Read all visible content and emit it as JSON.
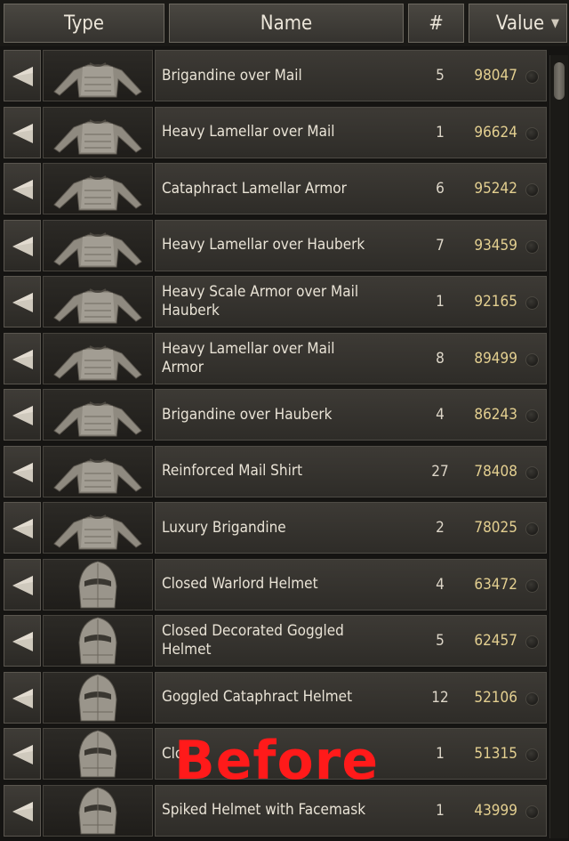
{
  "header": {
    "type_label": "Type",
    "name_label": "Name",
    "count_label": "#",
    "value_label": "Value",
    "sort_icon": "triangle-down-icon"
  },
  "items": [
    {
      "name": "Brigandine over Mail",
      "count": "5",
      "value": "98047",
      "icon": "body-armor-icon"
    },
    {
      "name": "Heavy Lamellar over Mail",
      "count": "1",
      "value": "96624",
      "icon": "body-armor-icon"
    },
    {
      "name": "Cataphract Lamellar Armor",
      "count": "6",
      "value": "95242",
      "icon": "body-armor-icon"
    },
    {
      "name": "Heavy Lamellar over Hauberk",
      "count": "7",
      "value": "93459",
      "icon": "body-armor-icon"
    },
    {
      "name": "Heavy Scale Armor over Mail Hauberk",
      "count": "1",
      "value": "92165",
      "icon": "body-armor-icon"
    },
    {
      "name": "Heavy Lamellar over Mail Armor",
      "count": "8",
      "value": "89499",
      "icon": "body-armor-icon"
    },
    {
      "name": "Brigandine over Hauberk",
      "count": "4",
      "value": "86243",
      "icon": "body-armor-icon"
    },
    {
      "name": "Reinforced Mail Shirt",
      "count": "27",
      "value": "78408",
      "icon": "body-armor-icon"
    },
    {
      "name": "Luxury Brigandine",
      "count": "2",
      "value": "78025",
      "icon": "body-armor-icon"
    },
    {
      "name": "Closed Warlord Helmet",
      "count": "4",
      "value": "63472",
      "icon": "helmet-icon"
    },
    {
      "name": "Closed Decorated Goggled Helmet",
      "count": "5",
      "value": "62457",
      "icon": "helmet-icon"
    },
    {
      "name": "Goggled Cataphract Helmet",
      "count": "12",
      "value": "52106",
      "icon": "helmet-icon"
    },
    {
      "name": "Clo",
      "count": "1",
      "value": "51315",
      "icon": "helmet-icon"
    },
    {
      "name": "Spiked Helmet with Facemask",
      "count": "1",
      "value": "43999",
      "icon": "helmet-icon"
    }
  ],
  "overlay": {
    "watermark_text": "Before",
    "watermark_color": "#ff1a1a"
  },
  "colors": {
    "value_text": "#e3cf90",
    "row_bg": "#3d3a35"
  }
}
